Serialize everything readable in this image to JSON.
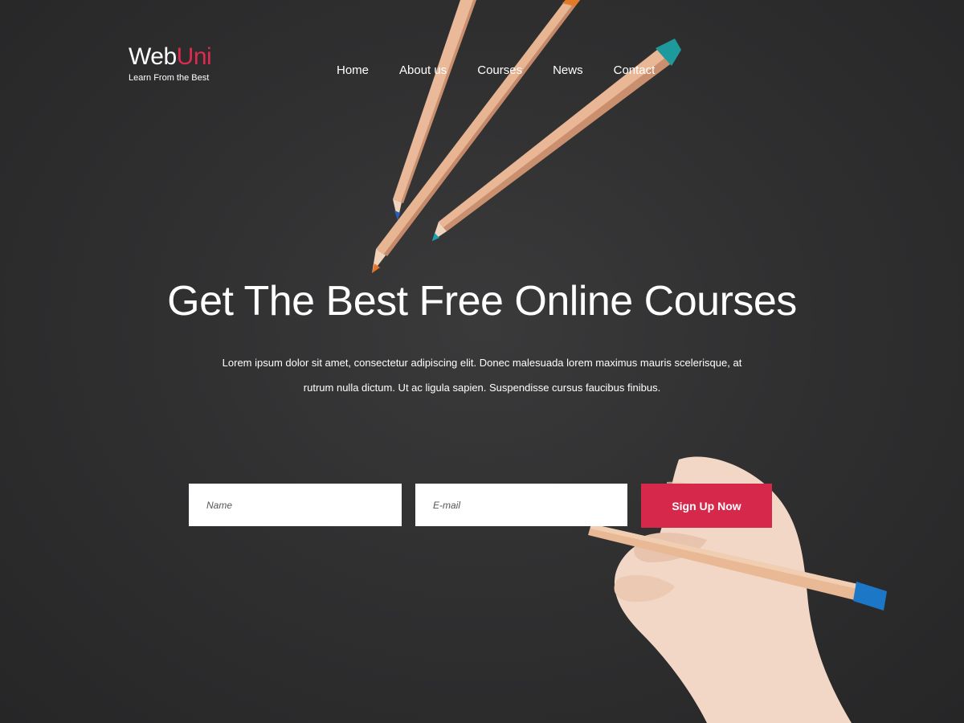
{
  "brand": {
    "name_part1": "Web",
    "name_part2": "Uni",
    "tagline": "Learn From the Best",
    "accent_color": "#e0294f"
  },
  "nav": {
    "items": [
      {
        "label": "Home"
      },
      {
        "label": "About us"
      },
      {
        "label": "Courses"
      },
      {
        "label": "News"
      },
      {
        "label": "Contact"
      }
    ]
  },
  "hero": {
    "title": "Get The Best Free Online Courses",
    "description": "Lorem ipsum dolor sit amet, consectetur adipiscing elit. Donec malesuada lorem maximus mauris scelerisque, at rutrum nulla dictum. Ut ac ligula sapien. Suspendisse cursus faucibus finibus."
  },
  "signup_form": {
    "name_placeholder": "Name",
    "email_placeholder": "E-mail",
    "button_label": "Sign Up Now",
    "button_color": "#d6284b"
  },
  "icons": [
    "pencil-illustration",
    "hand-holding-pencil-illustration"
  ]
}
